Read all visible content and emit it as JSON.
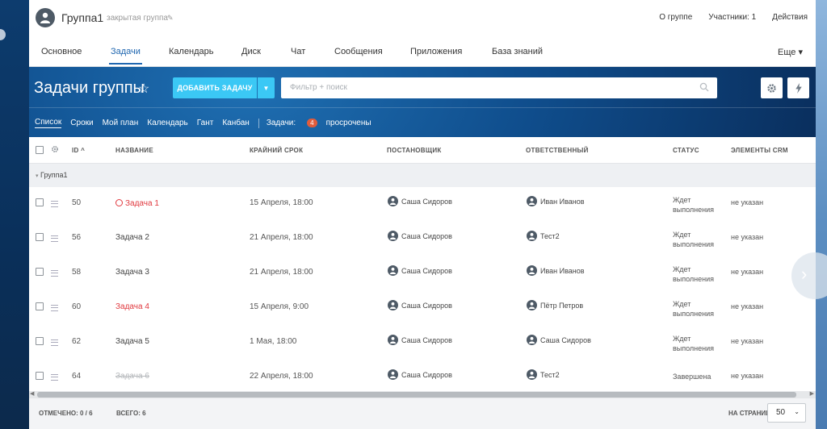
{
  "group": {
    "name": "Группа1",
    "type": "закрытая группа",
    "links": [
      "О группе",
      "Участники: 1",
      "Действия"
    ]
  },
  "tabs": [
    "Основное",
    "Задачи",
    "Календарь",
    "Диск",
    "Чат",
    "Сообщения",
    "Приложения",
    "База знаний"
  ],
  "tabs_more": "Еще",
  "active_tab": "Задачи",
  "page": {
    "title": "Задачи группы",
    "add_button": "ДОБАВИТЬ ЗАДАЧУ",
    "search_placeholder": "Фильтр + поиск"
  },
  "views": {
    "items": [
      "Список",
      "Сроки",
      "Мой план",
      "Календарь",
      "Гант",
      "Канбан"
    ],
    "active": "Список",
    "tasks_label": "Задачи:",
    "overdue_count": "4",
    "overdue_label": "просрочены"
  },
  "table": {
    "columns": {
      "id": "ID",
      "name": "НАЗВАНИЕ",
      "deadline": "КРАЙНИЙ СРОК",
      "creator": "ПОСТАНОВЩИК",
      "responsible": "ОТВЕТСТВЕННЫЙ",
      "status": "СТАТУС",
      "crm": "ЭЛЕМЕНТЫ CRM"
    },
    "group_label": "Группа1",
    "rows": [
      {
        "id": "50",
        "name": "Задача 1",
        "deadline": "15 Апреля, 18:00",
        "creator": "Саша Сидоров",
        "responsible": "Иван Иванов",
        "status": [
          "Ждет",
          "выполнения"
        ],
        "crm": "не указан",
        "state": "overdue",
        "flag": true
      },
      {
        "id": "56",
        "name": "Задача 2",
        "deadline": "21 Апреля, 18:00",
        "creator": "Саша Сидоров",
        "responsible": "Тест2",
        "status": [
          "Ждет",
          "выполнения"
        ],
        "crm": "не указан",
        "state": "normal",
        "flag": false
      },
      {
        "id": "58",
        "name": "Задача 3",
        "deadline": "21 Апреля, 18:00",
        "creator": "Саша Сидоров",
        "responsible": "Иван Иванов",
        "status": [
          "Ждет",
          "выполнения"
        ],
        "crm": "не указан",
        "state": "normal",
        "flag": false
      },
      {
        "id": "60",
        "name": "Задача 4",
        "deadline": "15 Апреля, 9:00",
        "creator": "Саша Сидоров",
        "responsible": "Пётр Петров",
        "status": [
          "Ждет",
          "выполнения"
        ],
        "crm": "не указан",
        "state": "overdue",
        "flag": false
      },
      {
        "id": "62",
        "name": "Задача 5",
        "deadline": "1 Мая, 18:00",
        "creator": "Саша Сидоров",
        "responsible": "Саша Сидоров",
        "status": [
          "Ждет",
          "выполнения"
        ],
        "crm": "не указан",
        "state": "normal",
        "flag": false
      },
      {
        "id": "64",
        "name": "Задача 6",
        "deadline": "22 Апреля, 18:00",
        "creator": "Саша Сидоров",
        "responsible": "Тест2",
        "status": [
          "Завершена"
        ],
        "crm": "не указан",
        "state": "done",
        "flag": false
      }
    ]
  },
  "footer": {
    "selected": "ОТМЕЧЕНО: 0 / 6",
    "total": "ВСЕГО: 6",
    "per_page_label": "НА СТРАНИЦЕ:",
    "per_page_value": "50"
  },
  "colors": {
    "accent": "#3bc8f5",
    "active_tab": "#2067b0",
    "overdue": "#e0383e",
    "badge": "#e15c3c"
  }
}
